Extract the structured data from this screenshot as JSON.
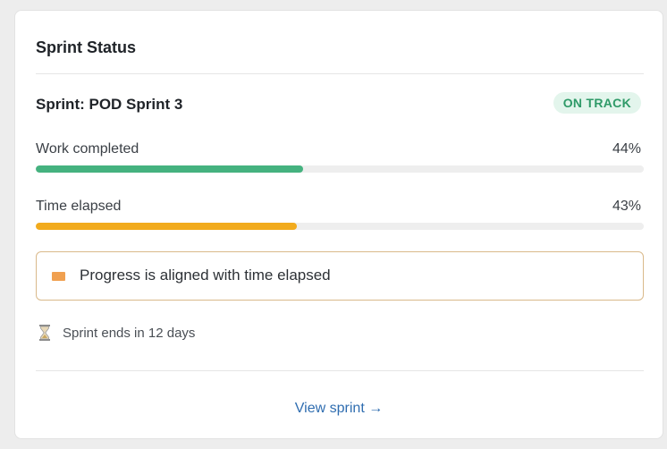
{
  "card": {
    "title": "Sprint Status"
  },
  "sprint": {
    "name": "Sprint: POD Sprint 3",
    "status": "ON TRACK",
    "status_bg": "#e3f5ec",
    "status_fg": "#2f9a68"
  },
  "metrics": [
    {
      "label": "Work completed",
      "value_text": "44%",
      "progress": 0.44,
      "color": "#45b27f"
    },
    {
      "label": "Time elapsed",
      "value_text": "43%",
      "progress": 0.43,
      "color": "#f2ab1d"
    }
  ],
  "alert": {
    "text": "Progress is aligned with time elapsed",
    "icon": "orange-square-icon",
    "icon_color": "#f0a050"
  },
  "countdown": {
    "icon": "hourglass-icon",
    "text": "Sprint ends in 12 days"
  },
  "footer": {
    "link_label": "View sprint →",
    "link_color": "#2f6db0"
  }
}
